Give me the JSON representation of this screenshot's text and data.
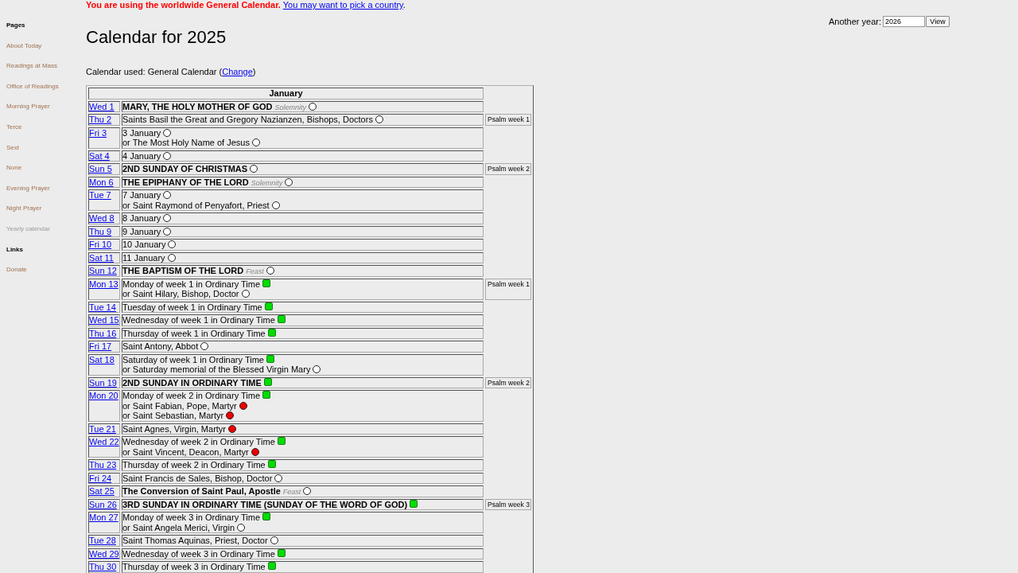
{
  "sidebar": {
    "sections": [
      {
        "heading": "Pages",
        "items": [
          {
            "label": "About Today",
            "selected": false
          },
          {
            "label": "Readings at Mass",
            "selected": false
          },
          {
            "label": "Office of Readings",
            "selected": false
          },
          {
            "label": "Morning Prayer",
            "selected": false
          },
          {
            "label": "Terce",
            "selected": false
          },
          {
            "label": "Sext",
            "selected": false
          },
          {
            "label": "None",
            "selected": false
          },
          {
            "label": "Evening Prayer",
            "selected": false
          },
          {
            "label": "Night Prayer",
            "selected": false
          },
          {
            "label": "Yearly calendar",
            "selected": true
          }
        ]
      },
      {
        "heading": "Links",
        "items": [
          {
            "label": "Donate",
            "selected": false
          }
        ]
      }
    ]
  },
  "notice": {
    "warning": "You are using the worldwide General Calendar.",
    "link": "You may want to pick a country",
    "after": "."
  },
  "year_form": {
    "label": "Another year:",
    "value": "2026",
    "button": "View"
  },
  "title": "Calendar for 2025",
  "calendar_used": {
    "before": "Calendar used: General Calendar (",
    "link": "Change",
    "after": ")"
  },
  "months": [
    {
      "name": "January",
      "days": [
        {
          "date": "Wed 1",
          "celebrations": [
            {
              "text": "MARY, THE HOLY MOTHER OF GOD",
              "bold": true,
              "rank": "Solemnity",
              "color": "#ffffff",
              "kind": "circle"
            }
          ]
        },
        {
          "date": "Thu 2",
          "celebrations": [
            {
              "text": "Saints Basil the Great and Gregory Nazianzen, Bishops, Doctors",
              "bold": false,
              "color": "#ffffff",
              "kind": "circle"
            }
          ],
          "psalm_week": "Psalm week 1"
        },
        {
          "date": "Fri 3",
          "celebrations": [
            {
              "text": "3 January",
              "bold": false,
              "color": "#ffffff",
              "kind": "circle"
            },
            {
              "text": "or The Most Holy Name of Jesus",
              "bold": false,
              "color": "#ffffff",
              "kind": "circle"
            }
          ]
        },
        {
          "date": "Sat 4",
          "celebrations": [
            {
              "text": "4 January",
              "bold": false,
              "color": "#ffffff",
              "kind": "circle"
            }
          ]
        },
        {
          "date": "Sun 5",
          "celebrations": [
            {
              "text": "2ND SUNDAY OF CHRISTMAS",
              "bold": true,
              "color": "#ffffff",
              "kind": "circle"
            }
          ],
          "psalm_week": "Psalm week 2"
        },
        {
          "date": "Mon 6",
          "celebrations": [
            {
              "text": "THE EPIPHANY OF THE LORD",
              "bold": true,
              "rank": "Solemnity",
              "color": "#ffffff",
              "kind": "circle"
            }
          ]
        },
        {
          "date": "Tue 7",
          "celebrations": [
            {
              "text": "7 January",
              "bold": false,
              "color": "#ffffff",
              "kind": "circle"
            },
            {
              "text": "or Saint Raymond of Penyafort, Priest",
              "bold": false,
              "color": "#ffffff",
              "kind": "circle"
            }
          ]
        },
        {
          "date": "Wed 8",
          "celebrations": [
            {
              "text": "8 January",
              "bold": false,
              "color": "#ffffff",
              "kind": "circle"
            }
          ]
        },
        {
          "date": "Thu 9",
          "celebrations": [
            {
              "text": "9 January",
              "bold": false,
              "color": "#ffffff",
              "kind": "circle"
            }
          ]
        },
        {
          "date": "Fri 10",
          "celebrations": [
            {
              "text": "10 January",
              "bold": false,
              "color": "#ffffff",
              "kind": "circle"
            }
          ]
        },
        {
          "date": "Sat 11",
          "celebrations": [
            {
              "text": "11 January",
              "bold": false,
              "color": "#ffffff",
              "kind": "circle"
            }
          ]
        },
        {
          "date": "Sun 12",
          "celebrations": [
            {
              "text": "THE BAPTISM OF THE LORD",
              "bold": true,
              "rank": "Feast",
              "color": "#ffffff",
              "kind": "circle"
            }
          ]
        },
        {
          "date": "Mon 13",
          "celebrations": [
            {
              "text": "Monday of week 1 in Ordinary Time",
              "bold": false,
              "color": "#00dd00",
              "kind": "square"
            },
            {
              "text": "or Saint Hilary, Bishop, Doctor",
              "bold": false,
              "color": "#ffffff",
              "kind": "circle"
            }
          ],
          "psalm_week": "Psalm week 1"
        },
        {
          "date": "Tue 14",
          "celebrations": [
            {
              "text": "Tuesday of week 1 in Ordinary Time",
              "bold": false,
              "color": "#00dd00",
              "kind": "square"
            }
          ]
        },
        {
          "date": "Wed 15",
          "celebrations": [
            {
              "text": "Wednesday of week 1 in Ordinary Time",
              "bold": false,
              "color": "#00dd00",
              "kind": "square"
            }
          ]
        },
        {
          "date": "Thu 16",
          "celebrations": [
            {
              "text": "Thursday of week 1 in Ordinary Time",
              "bold": false,
              "color": "#00dd00",
              "kind": "square"
            }
          ]
        },
        {
          "date": "Fri 17",
          "celebrations": [
            {
              "text": "Saint Antony, Abbot",
              "bold": false,
              "color": "#ffffff",
              "kind": "circle"
            }
          ]
        },
        {
          "date": "Sat 18",
          "celebrations": [
            {
              "text": "Saturday of week 1 in Ordinary Time",
              "bold": false,
              "color": "#00dd00",
              "kind": "square"
            },
            {
              "text": "or Saturday memorial of the Blessed Virgin Mary",
              "bold": false,
              "color": "#ffffff",
              "kind": "circle"
            }
          ]
        },
        {
          "date": "Sun 19",
          "celebrations": [
            {
              "text": "2ND SUNDAY IN ORDINARY TIME",
              "bold": true,
              "color": "#00dd00",
              "kind": "square"
            }
          ],
          "psalm_week": "Psalm week 2"
        },
        {
          "date": "Mon 20",
          "celebrations": [
            {
              "text": "Monday of week 2 in Ordinary Time",
              "bold": false,
              "color": "#00dd00",
              "kind": "square"
            },
            {
              "text": "or Saint Fabian, Pope, Martyr",
              "bold": false,
              "color": "#ee0000",
              "kind": "circle"
            },
            {
              "text": "or Saint Sebastian, Martyr",
              "bold": false,
              "color": "#ee0000",
              "kind": "circle"
            }
          ]
        },
        {
          "date": "Tue 21",
          "celebrations": [
            {
              "text": "Saint Agnes, Virgin, Martyr",
              "bold": false,
              "color": "#ee0000",
              "kind": "circle"
            }
          ]
        },
        {
          "date": "Wed 22",
          "celebrations": [
            {
              "text": "Wednesday of week 2 in Ordinary Time",
              "bold": false,
              "color": "#00dd00",
              "kind": "square"
            },
            {
              "text": "or Saint Vincent, Deacon, Martyr",
              "bold": false,
              "color": "#ee0000",
              "kind": "circle"
            }
          ]
        },
        {
          "date": "Thu 23",
          "celebrations": [
            {
              "text": "Thursday of week 2 in Ordinary Time",
              "bold": false,
              "color": "#00dd00",
              "kind": "square"
            }
          ]
        },
        {
          "date": "Fri 24",
          "celebrations": [
            {
              "text": "Saint Francis de Sales, Bishop, Doctor",
              "bold": false,
              "color": "#ffffff",
              "kind": "circle"
            }
          ]
        },
        {
          "date": "Sat 25",
          "celebrations": [
            {
              "text": "The Conversion of Saint Paul, Apostle",
              "bold": true,
              "rank": "Feast",
              "color": "#ffffff",
              "kind": "circle"
            }
          ]
        },
        {
          "date": "Sun 26",
          "celebrations": [
            {
              "text": "3RD SUNDAY IN ORDINARY TIME (SUNDAY OF THE WORD OF GOD)",
              "bold": true,
              "color": "#00dd00",
              "kind": "square"
            }
          ],
          "psalm_week": "Psalm week 3"
        },
        {
          "date": "Mon 27",
          "celebrations": [
            {
              "text": "Monday of week 3 in Ordinary Time",
              "bold": false,
              "color": "#00dd00",
              "kind": "square"
            },
            {
              "text": "or Saint Angela Merici, Virgin",
              "bold": false,
              "color": "#ffffff",
              "kind": "circle"
            }
          ]
        },
        {
          "date": "Tue 28",
          "celebrations": [
            {
              "text": "Saint Thomas Aquinas, Priest, Doctor",
              "bold": false,
              "color": "#ffffff",
              "kind": "circle"
            }
          ]
        },
        {
          "date": "Wed 29",
          "celebrations": [
            {
              "text": "Wednesday of week 3 in Ordinary Time",
              "bold": false,
              "color": "#00dd00",
              "kind": "square"
            }
          ]
        },
        {
          "date": "Thu 30",
          "celebrations": [
            {
              "text": "Thursday of week 3 in Ordinary Time",
              "bold": false,
              "color": "#00dd00",
              "kind": "square"
            }
          ]
        }
      ]
    }
  ]
}
